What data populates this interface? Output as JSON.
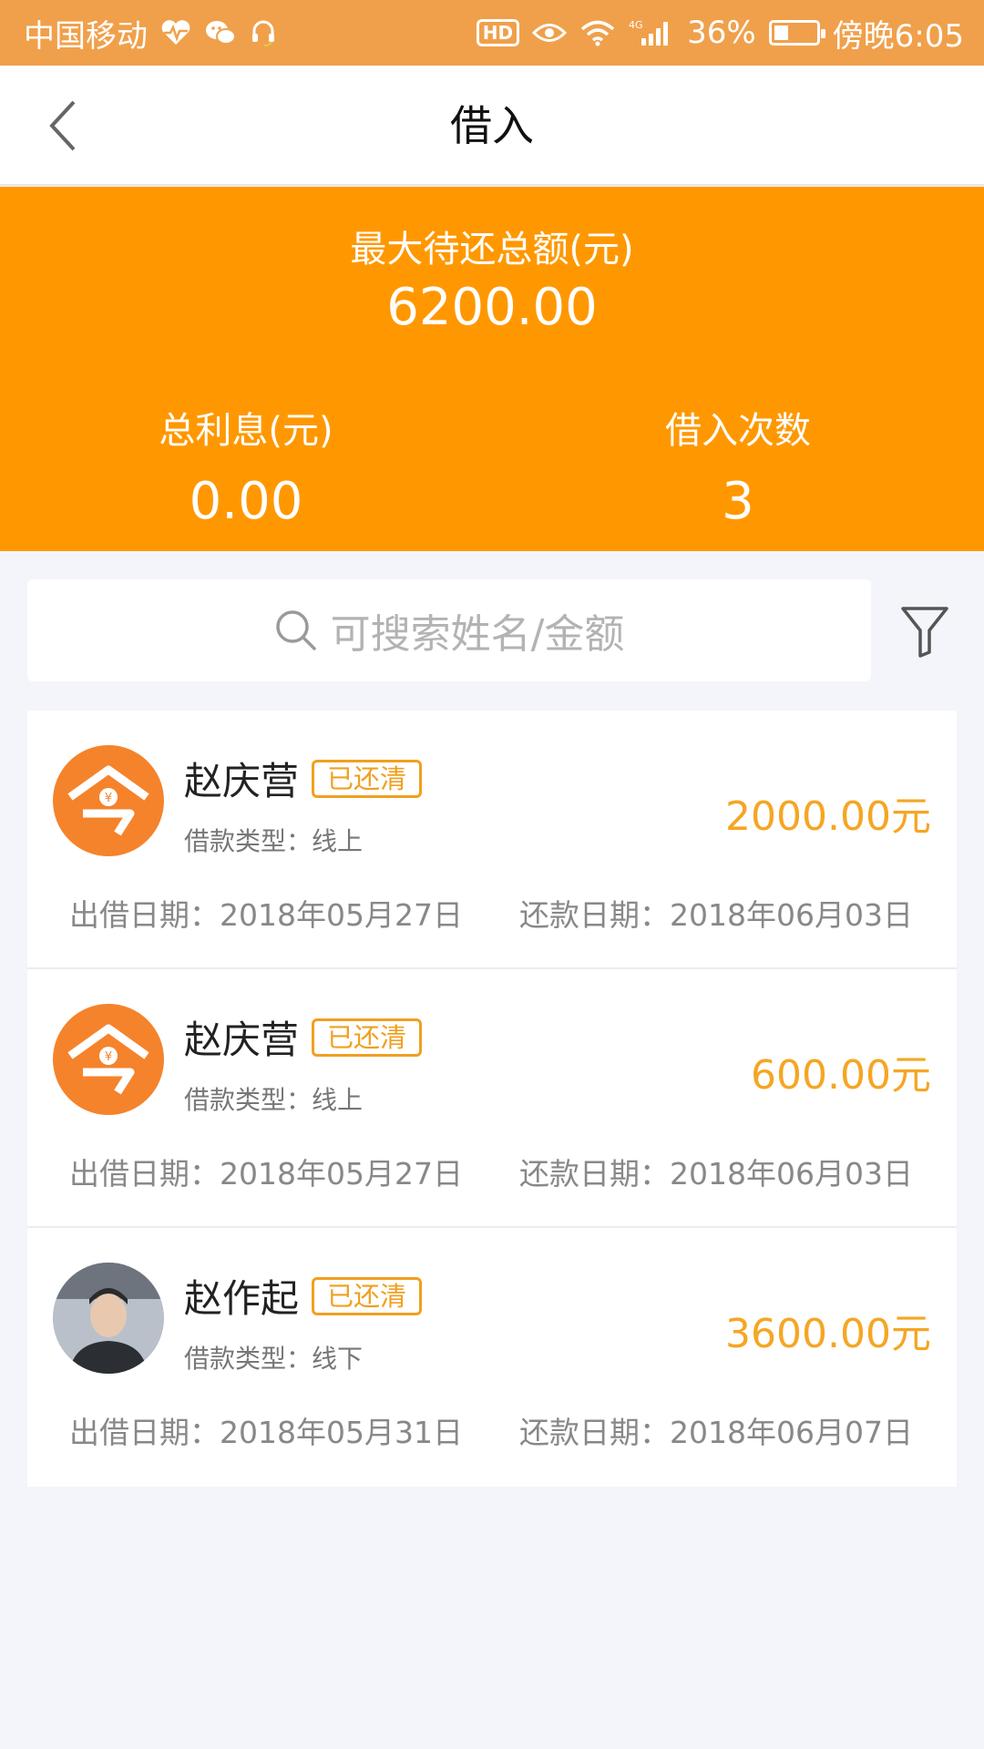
{
  "status_bar": {
    "carrier": "中国移动",
    "hd_label": "HD",
    "network": "4G",
    "battery": "36%",
    "battery_level": 0.36,
    "time": "傍晚6:05"
  },
  "nav": {
    "title": "借入"
  },
  "summary": {
    "max_label": "最大待还总额(元)",
    "max_value": "6200.00",
    "interest_label": "总利息(元)",
    "interest_value": "0.00",
    "count_label": "借入次数",
    "count_value": "3"
  },
  "search": {
    "placeholder": "可搜索姓名/金额"
  },
  "loans": [
    {
      "name": "赵庆营",
      "status": "已还清",
      "type_label": "借款类型：",
      "type_value": "线上",
      "amount": "2000.00",
      "unit": "元",
      "lend_label": "出借日期：",
      "lend_date": "2018年05月27日",
      "repay_label": "还款日期：",
      "repay_date": "2018年06月03日",
      "avatar": "logo"
    },
    {
      "name": "赵庆营",
      "status": "已还清",
      "type_label": "借款类型：",
      "type_value": "线上",
      "amount": "600.00",
      "unit": "元",
      "lend_label": "出借日期：",
      "lend_date": "2018年05月27日",
      "repay_label": "还款日期：",
      "repay_date": "2018年06月03日",
      "avatar": "logo"
    },
    {
      "name": "赵作起",
      "status": "已还清",
      "type_label": "借款类型：",
      "type_value": "线下",
      "amount": "3600.00",
      "unit": "元",
      "lend_label": "出借日期：",
      "lend_date": "2018年05月31日",
      "repay_label": "还款日期：",
      "repay_date": "2018年06月07日",
      "avatar": "photo"
    }
  ],
  "colors": {
    "status_bar": "#f0a04b",
    "banner": "#ff9800",
    "amount": "#f5a623",
    "badge": "#f0a020",
    "avatar_logo": "#f5832b"
  }
}
